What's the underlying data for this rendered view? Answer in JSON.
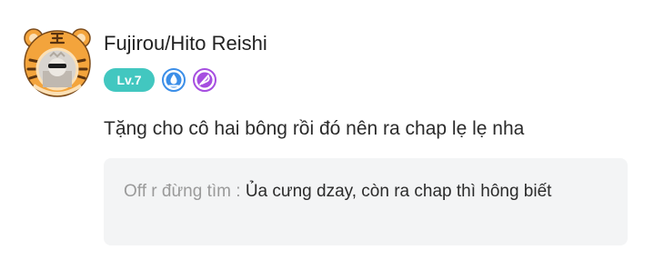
{
  "comment": {
    "avatar_icon": "tiger-hat-avatar-icon",
    "username": "Fujirou/Hito Reishi",
    "level": "Lv.7",
    "level_color": "#42c7c0",
    "badges": [
      {
        "icon": "water-drop-badge-icon",
        "color": "#3b8ee8"
      },
      {
        "icon": "feather-pen-badge-icon",
        "color": "#a64ee0"
      }
    ],
    "text": "Tặng cho cô hai bông rồi đó nên ra chap lẹ lẹ nha",
    "reply": {
      "author": "Off r đừng tìm :",
      "text": "Ủa cưng dzay, còn ra chap thì hông biết"
    }
  }
}
